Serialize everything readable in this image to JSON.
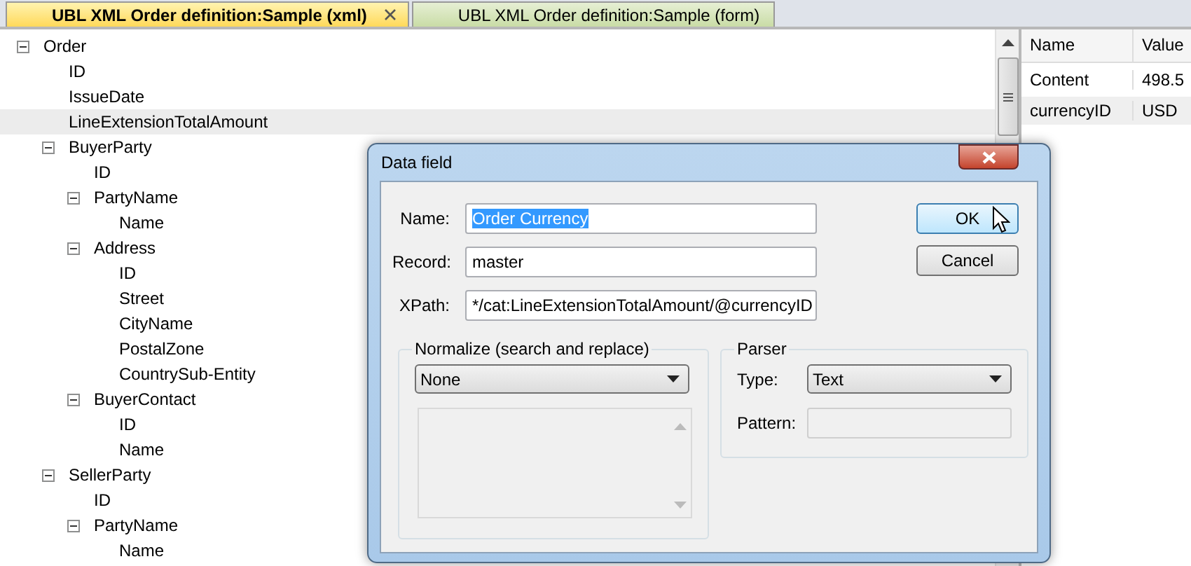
{
  "tabs": [
    {
      "label": "UBL XML Order definition:Sample (xml)",
      "selected": true,
      "closable": true
    },
    {
      "label": "UBL XML Order definition:Sample (form)",
      "selected": false,
      "closable": false
    }
  ],
  "tree": [
    {
      "label": "Order",
      "expanded": true,
      "selected": false,
      "children": [
        {
          "label": "ID",
          "selected": false
        },
        {
          "label": "IssueDate",
          "selected": false
        },
        {
          "label": "LineExtensionTotalAmount",
          "selected": true
        },
        {
          "label": "BuyerParty",
          "expanded": true,
          "selected": false,
          "children": [
            {
              "label": "ID",
              "selected": false
            },
            {
              "label": "PartyName",
              "expanded": true,
              "selected": false,
              "children": [
                {
                  "label": "Name",
                  "selected": false
                }
              ]
            },
            {
              "label": "Address",
              "expanded": true,
              "selected": false,
              "children": [
                {
                  "label": "ID",
                  "selected": false
                },
                {
                  "label": "Street",
                  "selected": false
                },
                {
                  "label": "CityName",
                  "selected": false
                },
                {
                  "label": "PostalZone",
                  "selected": false
                },
                {
                  "label": "CountrySub-Entity",
                  "selected": false
                }
              ]
            },
            {
              "label": "BuyerContact",
              "expanded": true,
              "selected": false,
              "children": [
                {
                  "label": "ID",
                  "selected": false
                },
                {
                  "label": "Name",
                  "selected": false
                }
              ]
            }
          ]
        },
        {
          "label": "SellerParty",
          "expanded": true,
          "selected": false,
          "children": [
            {
              "label": "ID",
              "selected": false
            },
            {
              "label": "PartyName",
              "expanded": true,
              "selected": false,
              "children": [
                {
                  "label": "Name",
                  "selected": false
                }
              ]
            }
          ]
        }
      ]
    }
  ],
  "properties": {
    "columns": [
      "Name",
      "Value"
    ],
    "rows": [
      {
        "name": "Content",
        "value": "498.5"
      },
      {
        "name": "currencyID",
        "value": "USD"
      }
    ]
  },
  "dialog": {
    "title": "Data field",
    "fields": [
      {
        "label": "Name:",
        "value": "Order Currency",
        "text_selected": true
      },
      {
        "label": "Record:",
        "value": "master",
        "text_selected": false
      },
      {
        "label": "XPath:",
        "value": "*/cat:LineExtensionTotalAmount/@currencyID",
        "text_selected": false
      }
    ],
    "buttons": [
      {
        "label": "OK",
        "focused": true
      },
      {
        "label": "Cancel",
        "focused": false
      }
    ],
    "normalize": {
      "title": "Normalize (search and replace)",
      "dropdown": "None"
    },
    "parser": {
      "title": "Parser",
      "type_label": "Type:",
      "type_value": "Text",
      "pattern_label": "Pattern:",
      "pattern_disabled": true
    }
  }
}
